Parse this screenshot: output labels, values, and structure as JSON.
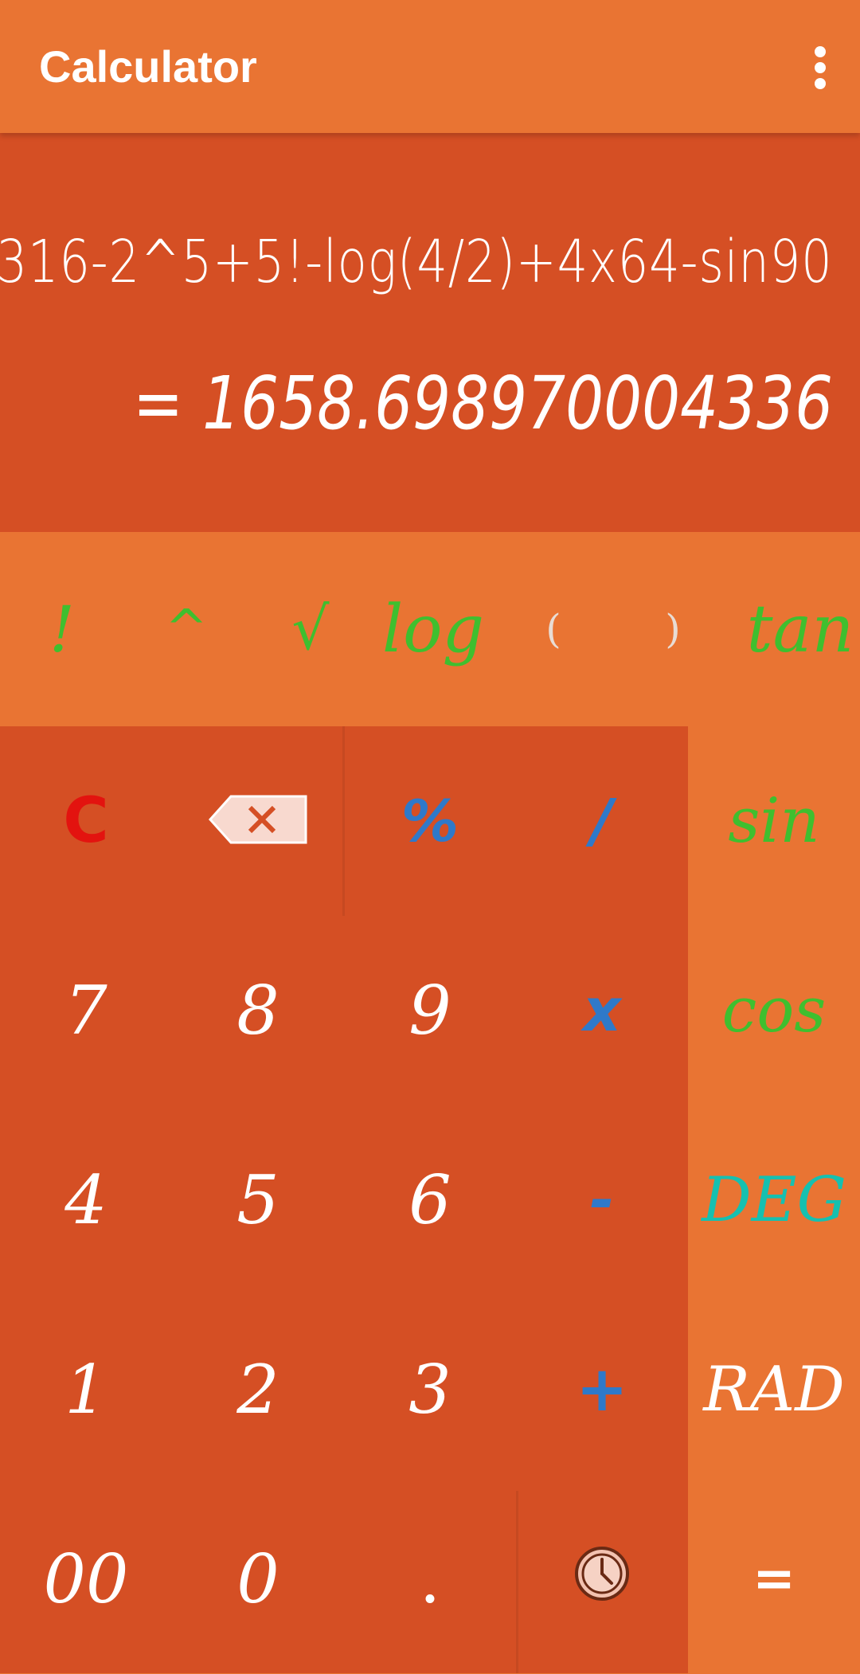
{
  "app_bar": {
    "title": "Calculator",
    "menu_icon": "more-vertical-icon"
  },
  "display": {
    "expression": "316-2^5+5!-log(4/2)+4x64-sin90",
    "result": "= 1658.698970004336"
  },
  "scientific_row": {
    "factorial": "!",
    "power": "^",
    "sqrt": "√",
    "log": "log",
    "open_paren": "(",
    "close_paren": ")",
    "tan": "tan"
  },
  "keypad": {
    "clear": "C",
    "backspace_icon": "backspace-icon",
    "percent": "%",
    "divide": "/",
    "seven": "7",
    "eight": "8",
    "nine": "9",
    "multiply": "x",
    "four": "4",
    "five": "5",
    "six": "6",
    "minus": "-",
    "one": "1",
    "two": "2",
    "three": "3",
    "plus": "+",
    "double_zero": "00",
    "zero": "0",
    "decimal": ".",
    "history_icon": "history-clock-icon"
  },
  "side_panel": {
    "sin": "sin",
    "cos": "cos",
    "deg": "DEG",
    "rad": "RAD",
    "equals": "="
  },
  "colors": {
    "primary": "#e97433",
    "dark_primary": "#d54f24",
    "function_green": "#3fbf2f",
    "operator_blue": "#2f79c9",
    "clear_red": "#e3130f",
    "deg_teal": "#16c0b0"
  }
}
